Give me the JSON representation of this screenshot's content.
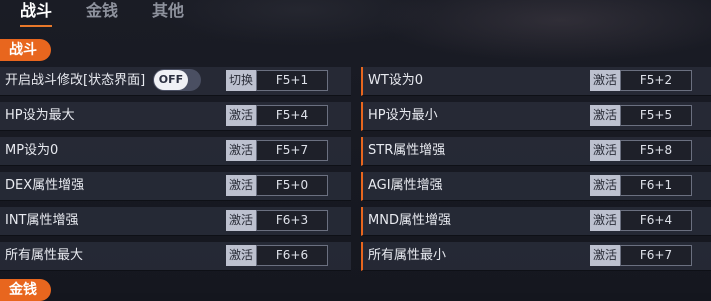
{
  "tabs": [
    "战斗",
    "金钱",
    "其他"
  ],
  "sections": {
    "combat": "战斗",
    "money": "金钱"
  },
  "toggle": {
    "state": "OFF"
  },
  "rows_left": [
    {
      "label": "开启战斗修改[状态界面]",
      "action": "切换",
      "key": "F5+1"
    },
    {
      "label": "HP设为最大",
      "action": "激活",
      "key": "F5+4"
    },
    {
      "label": "MP设为0",
      "action": "激活",
      "key": "F5+7"
    },
    {
      "label": "DEX属性增强",
      "action": "激活",
      "key": "F5+0"
    },
    {
      "label": "INT属性增强",
      "action": "激活",
      "key": "F6+3"
    },
    {
      "label": "所有属性最大",
      "action": "激活",
      "key": "F6+6"
    }
  ],
  "rows_right": [
    {
      "label": "WT设为0",
      "action": "激活",
      "key": "F5+2"
    },
    {
      "label": "HP设为最小",
      "action": "激活",
      "key": "F5+5"
    },
    {
      "label": "STR属性增强",
      "action": "激活",
      "key": "F5+8"
    },
    {
      "label": "AGI属性增强",
      "action": "激活",
      "key": "F6+1"
    },
    {
      "label": "MND属性增强",
      "action": "激活",
      "key": "F6+4"
    },
    {
      "label": "所有属性最小",
      "action": "激活",
      "key": "F6+7"
    }
  ],
  "colors": {
    "accent": "#e8661e",
    "row_bg": "#282b38",
    "hotkey_btn": "#bdc1cf"
  }
}
